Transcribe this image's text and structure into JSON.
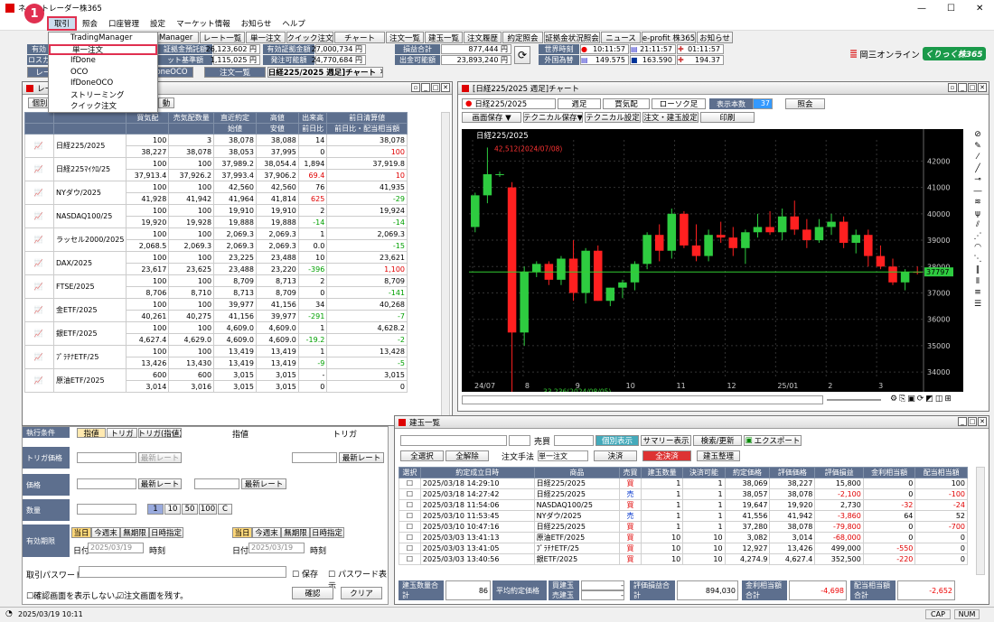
{
  "app": {
    "title": "ネットトレーダー株365",
    "window_min": "—",
    "window_max": "☐",
    "window_close": "✕"
  },
  "menu": [
    "取引",
    "照会",
    "口座管理",
    "設定",
    "マーケット情報",
    "お知らせ",
    "ヘルプ"
  ],
  "step_badge": "1",
  "dropdown": [
    "TradingManager",
    "単一注文",
    "IfDone",
    "OCO",
    "IfDoneOCO",
    "ストリーミング",
    "クイック注文"
  ],
  "toolbar": [
    "TradingManager",
    "レート一覧",
    "単一注文",
    "クイック注文",
    "チャート",
    "注文一覧",
    "建玉一覧",
    "注文履歴",
    "約定照会",
    "証拠金状況照会",
    "ニュース",
    "e-profit 株365",
    "お知らせ"
  ],
  "toolbar2": [
    "レート",
    "IfDoneOCO",
    "注文一覧",
    "[日経225/2025 週足]チャート"
  ],
  "info": {
    "l1": "有効",
    "l2": "ロスカ",
    "b1l": "証拠金預託額",
    "b1v": "26,123,602 円",
    "b2l": "ット基準額",
    "b2v": "1,115,025 円",
    "c1l": "有効証拠金額",
    "c1v": "27,000,734 円",
    "c2l": "発注可能額",
    "c2v": "24,770,684 円",
    "d1l": "損益合計",
    "d1v": "877,444 円",
    "d2l": "出金可能額",
    "d2v": "23,893,240 円",
    "e1l": "世界時刻",
    "e2l": "外国為替",
    "t1": "10:11:57",
    "t2": "21:11:57",
    "t3": "01:11:57",
    "fx1": "149.575",
    "fx2": "163.590",
    "fx3": "194.37",
    "brand": "岡三オンライン",
    "brand2": "くりっく株365"
  },
  "market": {
    "title": "レート一覧",
    "tabs": [
      "個別",
      "動"
    ],
    "headers": [
      "買気配",
      "売気配数量",
      "直近約定",
      "高値",
      "出来高",
      "前日清算値"
    ],
    "headers2": [
      "",
      "",
      "始値",
      "安値",
      "前日比",
      "前日比・配当相当額"
    ],
    "rows": [
      {
        "name": "日経225/2025",
        "a": [
          "100",
          "3",
          "38,078",
          "38,088",
          "14",
          "38,078"
        ],
        "b": [
          "38,227",
          "38,078",
          "38,053",
          "37,995",
          "0",
          "100"
        ]
      },
      {
        "name": "日経225ﾏｲｸﾛ/25",
        "a": [
          "100",
          "100",
          "37,989.2",
          "38,054.4",
          "1,894",
          "37,919.8"
        ],
        "b": [
          "37,913.4",
          "37,926.2",
          "37,993.4",
          "37,906.2",
          "69.4",
          "10"
        ]
      },
      {
        "name": "NYダウ/2025",
        "a": [
          "100",
          "100",
          "42,560",
          "42,560",
          "76",
          "41,935"
        ],
        "b": [
          "41,928",
          "41,942",
          "41,964",
          "41,814",
          "625",
          "-29"
        ]
      },
      {
        "name": "NASDAQ100/25",
        "a": [
          "100",
          "100",
          "19,910",
          "19,910",
          "2",
          "19,924"
        ],
        "b": [
          "19,920",
          "19,928",
          "19,888",
          "19,888",
          "-14",
          "-14"
        ]
      },
      {
        "name": "ラッセル2000/2025",
        "a": [
          "100",
          "100",
          "2,069.3",
          "2,069.3",
          "1",
          "2,069.3"
        ],
        "b": [
          "2,068.5",
          "2,069.3",
          "2,069.3",
          "2,069.3",
          "0.0",
          "-15"
        ]
      },
      {
        "name": "DAX/2025",
        "a": [
          "100",
          "100",
          "23,225",
          "23,488",
          "10",
          "23,621"
        ],
        "b": [
          "23,617",
          "23,625",
          "23,488",
          "23,220",
          "-396",
          "1,100"
        ]
      },
      {
        "name": "FTSE/2025",
        "a": [
          "100",
          "100",
          "8,709",
          "8,713",
          "2",
          "8,709"
        ],
        "b": [
          "8,706",
          "8,710",
          "8,713",
          "8,709",
          "0",
          "-141"
        ]
      },
      {
        "name": "金ETF/2025",
        "a": [
          "100",
          "100",
          "39,977",
          "41,156",
          "34",
          "40,268"
        ],
        "b": [
          "40,261",
          "40,275",
          "41,156",
          "39,977",
          "-291",
          "-7"
        ]
      },
      {
        "name": "銀ETF/2025",
        "a": [
          "100",
          "100",
          "4,609.0",
          "4,609.0",
          "1",
          "4,628.2"
        ],
        "b": [
          "4,627.4",
          "4,629.0",
          "4,609.0",
          "4,609.0",
          "-19.2",
          "-2"
        ]
      },
      {
        "name": "ﾌﾟﾗﾁﾅETF/25",
        "a": [
          "100",
          "100",
          "13,419",
          "13,419",
          "1",
          "13,428"
        ],
        "b": [
          "13,426",
          "13,430",
          "13,419",
          "13,419",
          "-9",
          "-5"
        ]
      },
      {
        "name": "原油ETF/2025",
        "a": [
          "600",
          "600",
          "3,015",
          "3,015",
          "-",
          "3,015"
        ],
        "b": [
          "3,014",
          "3,016",
          "3,015",
          "3,015",
          "0",
          "0"
        ]
      }
    ]
  },
  "order": {
    "labels": [
      "執行条件",
      "トリガ価格",
      "価格",
      "数量",
      "有効期限",
      "取引パスワード"
    ],
    "cond": [
      "指値",
      "トリガ",
      "トリガ(指値)"
    ],
    "cond2": [
      "指値",
      "トリガ"
    ],
    "latest": "最新レート",
    "qty": [
      "1",
      "10",
      "50",
      "100",
      "C"
    ],
    "exp": [
      "当日",
      "今週末",
      "無期限",
      "日時指定"
    ],
    "date_lbl": "日付",
    "date": "2025/03/19",
    "time_lbl": "時刻",
    "save": "保存",
    "showpw": "パスワード表示",
    "noconfirm": "確認画面を表示しない。",
    "keep": "注文画面を残す。",
    "confirm": "確認",
    "clear": "クリア"
  },
  "chart": {
    "title": "[日経225/2025 週足]チャート",
    "symbol": "日経225/2025",
    "period": "週足",
    "side": "買気配",
    "candle": "ローソク足",
    "count_lbl": "表示本数",
    "count": "37",
    "inquiry": "照会",
    "b1": "画面保存 ▼",
    "b2": "テクニカル保存▼",
    "b3": "テクニカル設定",
    "b4": "注文・建玉設定",
    "b5": "印刷",
    "legend": "日経225/2025",
    "hi": "42,512(2024/07/08)",
    "lo": "33,236(2024/08/05)",
    "last": "37797",
    "yticks": [
      "42000",
      "41000",
      "40000",
      "39000",
      "38000",
      "37000",
      "36000",
      "35000",
      "34000"
    ],
    "xticks": [
      "24/07",
      "8",
      "9",
      "10",
      "11",
      "12",
      "25/01",
      "2",
      "3"
    ]
  },
  "chart_data": {
    "type": "candlestick",
    "candles": [
      [
        39500,
        40800,
        39300,
        40700
      ],
      [
        40700,
        42512,
        40400,
        41500
      ],
      [
        41500,
        41600,
        41400,
        41500
      ],
      [
        41000,
        41200,
        33236,
        35500
      ],
      [
        35500,
        38000,
        35000,
        37800
      ],
      [
        37800,
        38200,
        37600,
        38100
      ],
      [
        38100,
        38200,
        37300,
        37500
      ],
      [
        37500,
        38400,
        37300,
        38300
      ],
      [
        38300,
        39000,
        36700,
        37000
      ],
      [
        37000,
        38700,
        36600,
        38600
      ],
      [
        38600,
        38800,
        36700,
        36700
      ],
      [
        36700,
        37200,
        36500,
        37200
      ],
      [
        37200,
        37500,
        36800,
        37400
      ],
      [
        37400,
        38200,
        37100,
        38100
      ],
      [
        38100,
        39300,
        37900,
        39200
      ],
      [
        39200,
        39600,
        38200,
        38600
      ],
      [
        38600,
        40200,
        38300,
        40000
      ],
      [
        40000,
        40100,
        38700,
        38800
      ],
      [
        38800,
        39600,
        38200,
        38400
      ],
      [
        38400,
        39400,
        38200,
        39200
      ],
      [
        39200,
        39700,
        38900,
        39100
      ],
      [
        39100,
        39500,
        38400,
        38700
      ],
      [
        38700,
        39400,
        38100,
        39300
      ],
      [
        39300,
        40000,
        39100,
        39500
      ],
      [
        39500,
        40100,
        39200,
        39300
      ],
      [
        39300,
        40200,
        39000,
        39900
      ],
      [
        39900,
        40500,
        39200,
        39400
      ],
      [
        39400,
        39800,
        38700,
        39000
      ],
      [
        39000,
        39800,
        38900,
        39500
      ],
      [
        39500,
        40000,
        39200,
        39700
      ],
      [
        39700,
        39900,
        38700,
        38900
      ],
      [
        38900,
        39400,
        38500,
        39200
      ],
      [
        39200,
        39400,
        38000,
        38400
      ],
      [
        38400,
        38800,
        37900,
        38000
      ],
      [
        38000,
        38300,
        37300,
        37400
      ],
      [
        37400,
        37900,
        37100,
        37800
      ],
      [
        37800,
        38000,
        37700,
        37797
      ]
    ]
  },
  "positions": {
    "title": "建玉一覧",
    "side_lbl": "売買",
    "btns": [
      "個別表示",
      "サマリー表示",
      "検索/更新",
      "エクスポート"
    ],
    "sel_all": "全選択",
    "unsel": "全解除",
    "method_lbl": "注文手法",
    "method": "単一注文",
    "settle": "決済",
    "all_settle": "全決済",
    "arrange": "建玉整理",
    "headers": [
      "選択",
      "約定成立日時",
      "商品",
      "売買",
      "建玉数量",
      "決済可能",
      "約定価格",
      "評価価格",
      "評価損益",
      "金利相当額",
      "配当相当額"
    ],
    "rows": [
      [
        "2025/03/18 14:29:10",
        "日経225/2025",
        "買",
        "1",
        "1",
        "38,069",
        "38,227",
        "15,800",
        "0",
        "100"
      ],
      [
        "2025/03/18 14:27:42",
        "日経225/2025",
        "売",
        "1",
        "1",
        "38,057",
        "38,078",
        "-2,100",
        "0",
        "-100"
      ],
      [
        "2025/03/18 11:54:06",
        "NASDAQ100/25",
        "買",
        "1",
        "1",
        "19,647",
        "19,920",
        "2,730",
        "-32",
        "-24"
      ],
      [
        "2025/03/10 11:53:45",
        "NYダウ/2025",
        "売",
        "1",
        "1",
        "41,556",
        "41,942",
        "-3,860",
        "64",
        "52"
      ],
      [
        "2025/03/10 10:47:16",
        "日経225/2025",
        "買",
        "1",
        "1",
        "37,280",
        "38,078",
        "-79,800",
        "0",
        "-700"
      ],
      [
        "2025/03/03 13:41:13",
        "原油ETF/2025",
        "買",
        "10",
        "10",
        "3,082",
        "3,014",
        "-68,000",
        "0",
        "0"
      ],
      [
        "2025/03/03 13:41:05",
        "ﾌﾟﾗﾁﾅETF/25",
        "買",
        "10",
        "10",
        "12,927",
        "13,426",
        "499,000",
        "-550",
        "0"
      ],
      [
        "2025/03/03 13:40:56",
        "銀ETF/2025",
        "買",
        "10",
        "10",
        "4,274.9",
        "4,627.4",
        "352,500",
        "-220",
        "0"
      ]
    ],
    "sum": {
      "qty_lbl": "建玉数量合計",
      "qty": "86",
      "avg_lbl": "平均約定価格",
      "buy_lbl": "買建玉",
      "sell_lbl": "売建玉",
      "dash": "-",
      "pl_lbl": "評価損益合計",
      "pl": "894,030",
      "int_lbl": "金利相当額合計",
      "int": "-4,698",
      "div_lbl": "配当相当額合計",
      "div": "-2,652"
    }
  },
  "status": {
    "time": "2025/03/19 10:11",
    "cap": "CAP",
    "num": "NUM"
  }
}
